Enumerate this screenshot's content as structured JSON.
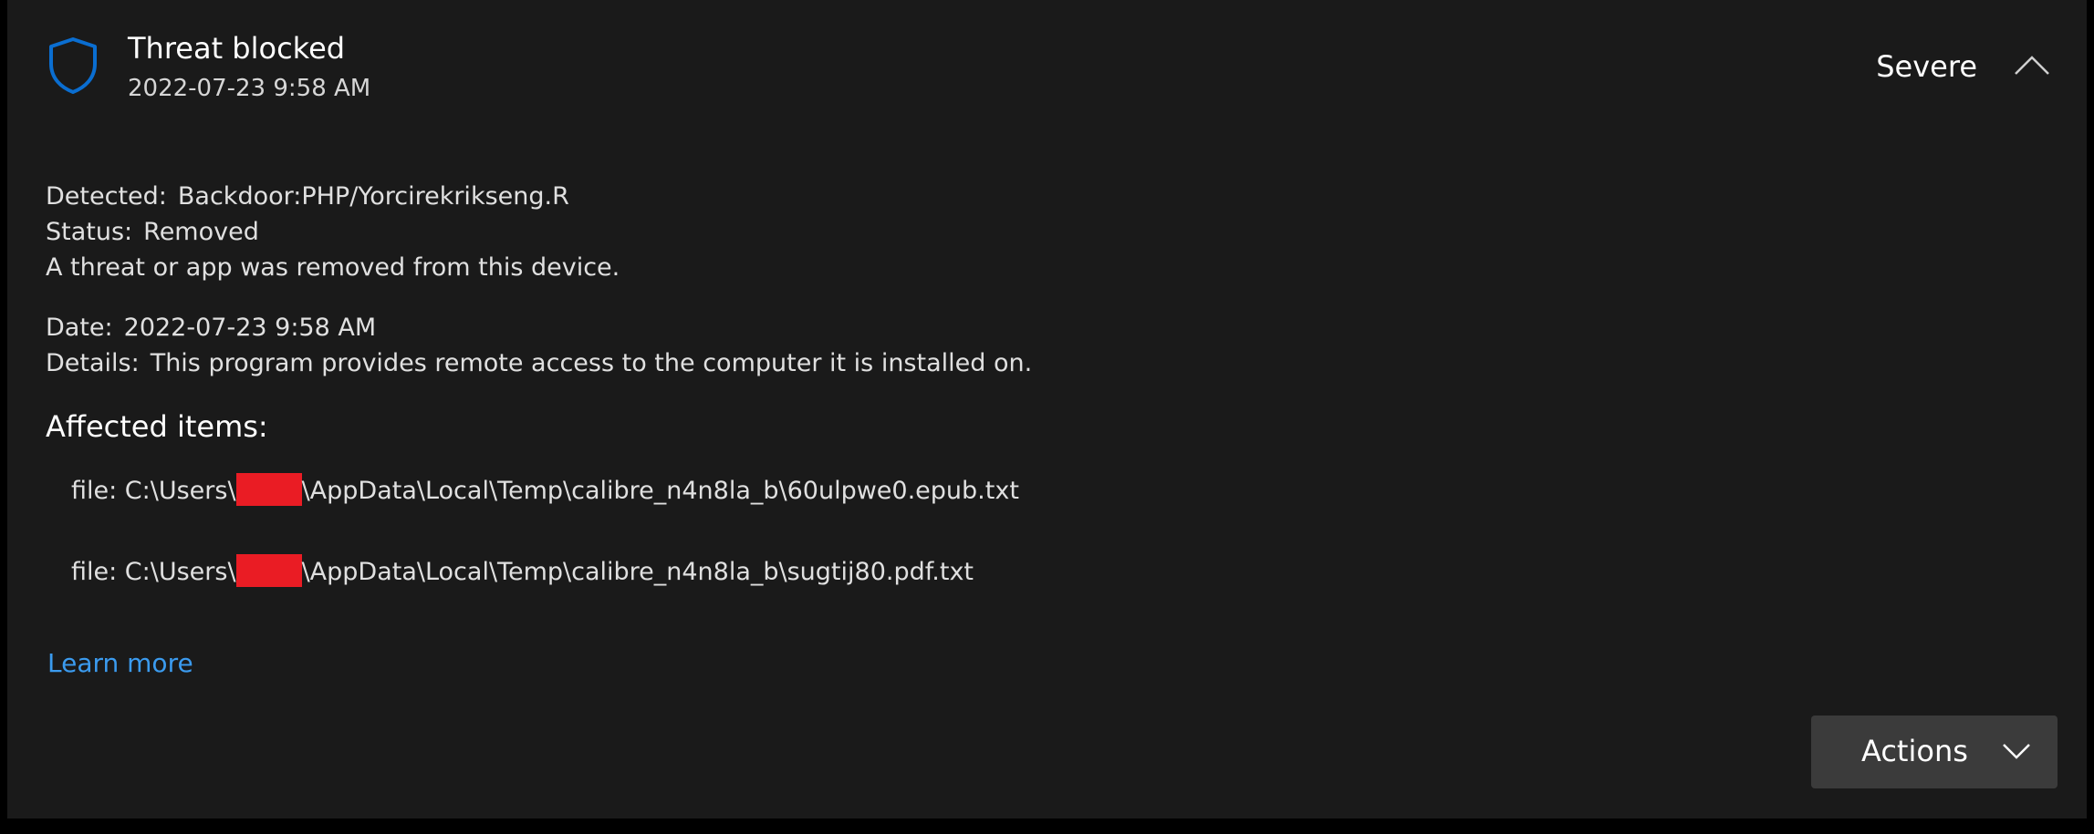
{
  "header": {
    "title": "Threat blocked",
    "timestamp": "2022-07-23 9:58 AM",
    "severity": "Severe",
    "shield_icon": "shield-icon",
    "collapse_icon": "chevron-up-icon"
  },
  "details": {
    "detected_key": "Detected:",
    "detected_value": "Backdoor:PHP/Yorcirekrikseng.R",
    "status_key": "Status:",
    "status_value": "Removed",
    "status_message": "A threat or app was removed from this device.",
    "date_key": "Date:",
    "date_value": "2022-07-23 9:58 AM",
    "details_key": "Details:",
    "details_value": "This program provides remote access to the computer it is installed on."
  },
  "affected": {
    "heading": "Affected items:",
    "items": [
      {
        "prefix": "file: C:\\Users\\",
        "suffix": "\\AppData\\Local\\Temp\\calibre_n4n8la_b\\60ulpwe0.epub.txt"
      },
      {
        "prefix": "file: C:\\Users\\",
        "suffix": "\\AppData\\Local\\Temp\\calibre_n4n8la_b\\sugtij80.pdf.txt"
      }
    ]
  },
  "learn_more": "Learn more",
  "actions": {
    "label": "Actions",
    "icon": "chevron-down-icon"
  },
  "colors": {
    "panel_bg": "#1a1a1a",
    "accent_blue": "#0a6ed1",
    "link_blue": "#3b9bef",
    "redaction": "#ea1c24",
    "button_bg": "#3b3b3b"
  }
}
